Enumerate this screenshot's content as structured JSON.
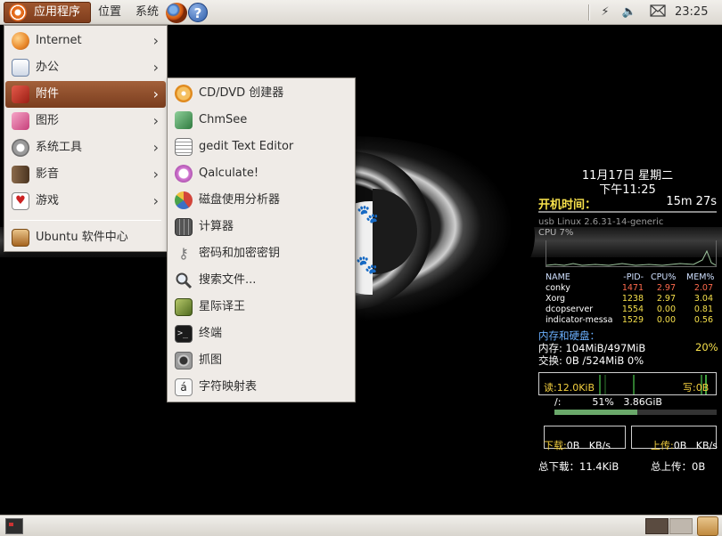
{
  "top_panel": {
    "applications": "应用程序",
    "places": "位置",
    "system": "系统",
    "help_glyph": "?",
    "clock": "23:25"
  },
  "main_menu": {
    "items": [
      {
        "label": "Internet",
        "icon": "internet-globe-icon",
        "color": "#e8872a",
        "has_submenu": true
      },
      {
        "label": "办公",
        "icon": "office-icon",
        "color": "#4a7fc1",
        "has_submenu": true
      },
      {
        "label": "附件",
        "icon": "accessories-icon",
        "color": "#c9302c",
        "has_submenu": true,
        "active": true
      },
      {
        "label": "图形",
        "icon": "graphics-icon",
        "color": "#d94c8a",
        "has_submenu": true
      },
      {
        "label": "系统工具",
        "icon": "system-tools-gear-icon",
        "color": "#8a8a8a",
        "has_submenu": true
      },
      {
        "label": "影音",
        "icon": "multimedia-icon",
        "color": "#7a5a3a",
        "has_submenu": true
      },
      {
        "label": "游戏",
        "icon": "games-cards-icon",
        "color": "#c22",
        "has_submenu": true
      },
      {
        "label": "Ubuntu 软件中心",
        "icon": "software-center-icon",
        "color": "#b5742c",
        "has_submenu": false
      }
    ]
  },
  "sub_menu": {
    "items": [
      {
        "label": "CD/DVD 创建器",
        "icon": "cd-dvd-icon",
        "color": "#e8a33a"
      },
      {
        "label": "ChmSee",
        "icon": "chmsee-icon",
        "color": "#4b9d5b"
      },
      {
        "label": "gedit Text Editor",
        "icon": "text-editor-icon",
        "color": "#dcdcdc"
      },
      {
        "label": "Qalculate!",
        "icon": "qalculate-icon",
        "color": "#c05fc0"
      },
      {
        "label": "磁盘使用分析器",
        "icon": "disk-usage-pie-icon",
        "color": "#d2453a"
      },
      {
        "label": "计算器",
        "icon": "calculator-icon",
        "color": "#6b6b6b"
      },
      {
        "label": "密码和加密密钥",
        "icon": "keys-icon",
        "color": "#a8a8a8"
      },
      {
        "label": "搜索文件...",
        "icon": "search-magnifier-icon",
        "color": "#555555"
      },
      {
        "label": "星际译王",
        "icon": "dictionary-book-icon",
        "color": "#6f8f2f"
      },
      {
        "label": "终端",
        "icon": "terminal-icon",
        "color": "#222222"
      },
      {
        "label": "抓图",
        "icon": "screenshot-camera-icon",
        "color": "#9a9a9a"
      },
      {
        "label": "字符映射表",
        "icon": "character-map-icon",
        "color": "#eeeeee"
      }
    ]
  },
  "conky": {
    "date": "11月17日 星期二",
    "time": "下午11:25",
    "uptime_label": "开机时间：",
    "uptime_value": "15m 27s",
    "usb_line": "usb  Linux 2.6.31-14-generic",
    "cpu_line": "CPU   7%",
    "process_header": {
      "name": "NAME",
      "pid": "-PID-",
      "cpu": "CPU%",
      "mem": "MEM%"
    },
    "processes": [
      {
        "name": "conky",
        "pid": "1471",
        "cpu": "2.97",
        "mem": "2.07"
      },
      {
        "name": "Xorg",
        "pid": "1238",
        "cpu": "2.97",
        "mem": "3.04"
      },
      {
        "name": "dcopserver",
        "pid": "1554",
        "cpu": "0.00",
        "mem": "0.81"
      },
      {
        "name": "indicator-messa",
        "pid": "1529",
        "cpu": "0.00",
        "mem": "0.56"
      }
    ],
    "mem_section": "内存和硬盘：",
    "mem_line": "内存: 104MiB/497MiB",
    "mem_pct": "20%",
    "swap_line": "交换: 0B  /524MiB 0%",
    "io_read": "读:12.0KiB",
    "io_write": "写:0B",
    "root_line": "/:          51%   3.86GiB",
    "root_usage_fraction": 0.51,
    "down_label": "下载:",
    "down_rate": "0B   KB/s",
    "up_label": "上传:",
    "up_rate": "0B   KB/s",
    "total_down": "总下载：11.4KiB",
    "total_up": "总上传：0B"
  },
  "colors": {
    "menu_highlight": "#8e4a27",
    "conky_yellow": "#f6e04b",
    "conky_blue": "#6bb0ff",
    "pid_red": "#ff6a4d"
  }
}
